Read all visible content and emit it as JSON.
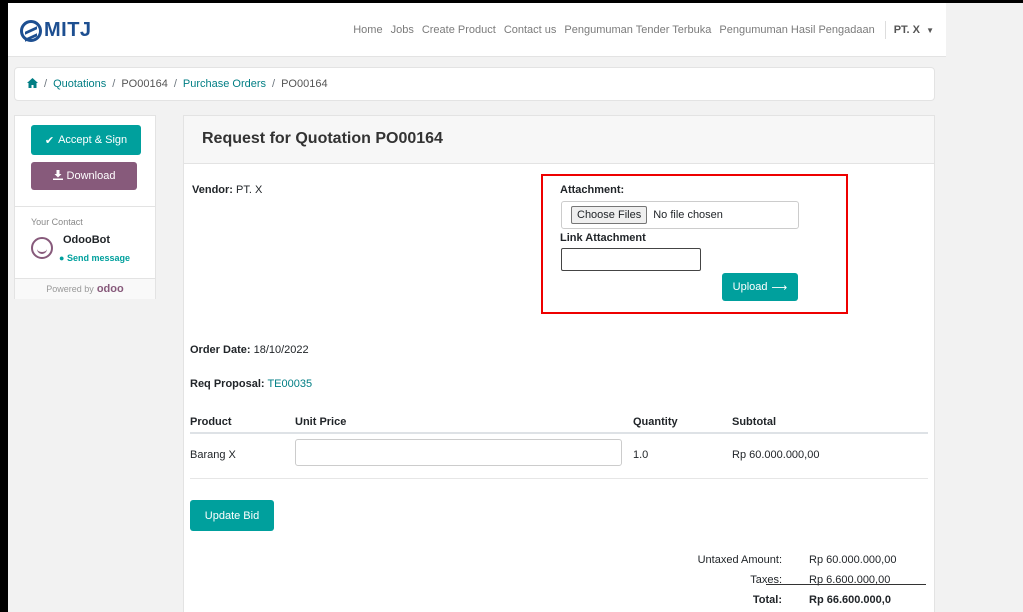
{
  "navbar": {
    "logo_text": "MITJ",
    "links": [
      "Home",
      "Jobs",
      "Create Product",
      "Contact us",
      "Pengumuman Tender Terbuka",
      "Pengumuman Hasil Pengadaan"
    ],
    "user": "PT. X"
  },
  "breadcrumb": {
    "items": [
      "Quotations",
      "PO00164",
      "Purchase Orders",
      "PO00164"
    ]
  },
  "sidebar": {
    "accept_label": "Accept & Sign",
    "download_label": "Download",
    "contact_label": "Your Contact",
    "contact_name": "OdooBot",
    "send_message": "Send message",
    "powered_by": "Powered by",
    "powered_brand": "odoo"
  },
  "main": {
    "title": "Request for Quotation PO00164",
    "vendor_label": "Vendor:",
    "vendor_value": "PT. X",
    "attachment_label": "Attachment:",
    "choose_files": "Choose Files",
    "no_file": "No file chosen",
    "link_attachment_label": "Link Attachment",
    "upload_label": "Upload",
    "order_date_label": "Order Date:",
    "order_date_value": "18/10/2022",
    "req_proposal_label": "Req Proposal:",
    "req_proposal_value": "TE00035",
    "table": {
      "headers": [
        "Product",
        "Unit Price",
        "Quantity",
        "Subtotal"
      ],
      "rows": [
        {
          "product": "Barang X",
          "unit_price": "",
          "quantity": "1.0",
          "subtotal": "Rp 60.000.000,00"
        }
      ]
    },
    "update_bid_label": "Update Bid",
    "totals": {
      "untaxed_label": "Untaxed Amount:",
      "untaxed_value": "Rp 60.000.000,00",
      "taxes_label": "Taxes:",
      "taxes_value": "Rp 6.600.000,00",
      "total_label": "Total:",
      "total_value": "Rp 66.600.000,0"
    }
  },
  "colors": {
    "primary": "#00a09d",
    "secondary": "#875a7b",
    "link": "#017e84",
    "highlight_box": "#ee0000"
  }
}
